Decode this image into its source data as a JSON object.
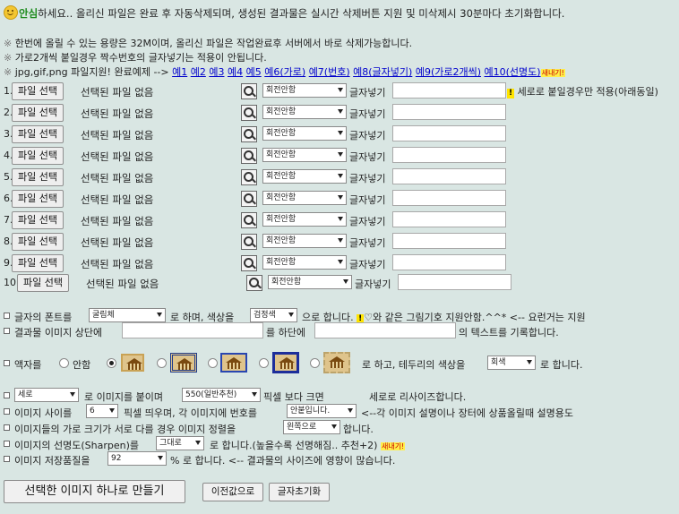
{
  "notice": {
    "safe": "안심",
    "text": "하세요.. 올리신 파일은 완료 후 자동삭제되며, 생성된 결과물은 실시간 삭제버튼 지원 및 미삭제시 30분마다 초기화합니다."
  },
  "info": {
    "mark": "※",
    "line1": "한번에 올릴 수 있는 용량은 32M이며, 올리신 파일은 작업완료후 서버에서 바로 삭제가능합니다.",
    "line2": "가로2개씩 붙일경우 짝수번호의 글자넣기는 적용이 안됩니다.",
    "line3_prefix": "jpg,gif,png 파일지원! 완료예제 -->",
    "examples": [
      "예1",
      "예2",
      "예3",
      "예4",
      "예5",
      "예6(가로)",
      "예7(번호)",
      "예8(글자넣기)",
      "예9(가로2개씩)",
      "예10(선명도)"
    ],
    "new_badge": "새내기!"
  },
  "file_rows": {
    "choose_label": "파일 선택",
    "no_file": "선택된 파일 없음",
    "rotate_value": "회전안함",
    "text_label": "글자넣기",
    "numbers": [
      "1.",
      "2.",
      "3.",
      "4.",
      "5.",
      "6.",
      "7.",
      "8.",
      "9.",
      "10."
    ],
    "row1_tip_mark": "!",
    "row1_tip": "세로로 붙일경우만 적용(아래동일)"
  },
  "font_row": {
    "p1": "글자의 폰트를",
    "font": "굴림체",
    "p2": "로 하며, 색상을",
    "color": "검정색",
    "p3": "으로 합니다.",
    "excl": "!",
    "p4": "♡와 같은 그림기호 지원안함.^^* <-- 요런거는 지원"
  },
  "record_row": {
    "p1": "결과물 이미지 상단에",
    "p2": "를 하단에",
    "p3": "의 텍스트를 기록합니다."
  },
  "frame_row": {
    "p1": "액자를",
    "none": "안함",
    "p2": "로 하고, 테두리의 색상을",
    "border_color": "회색",
    "p3": "로 합니다."
  },
  "options": {
    "direction": "세로",
    "o1a": "로 이미지를 붙이며",
    "size": "550(일반추천)",
    "o1b": "픽셀 보다 크면",
    "o1c": "세로로 리사이즈합니다.",
    "gap_label": "이미지 사이를",
    "gap": "6",
    "o2a": "픽셀 띄우며, 각 이미지에 번호를",
    "number_opt": "안붙입니다.",
    "o2b": "<--각 이미지 설명이나 장터에 상품올릴때 설명용도",
    "o3a": "이미지들의 가로 크기가 서로 다를 경우 이미지 정렬을",
    "align": "왼쪽으로",
    "o3b": "합니다.",
    "o4a": "이미지의 선명도(Sharpen)를",
    "sharpen": "그대로",
    "o4b": "로 합니다.(높을수록 선명해짐.. 추천+2)",
    "o4badge": "새내기!",
    "o5a": "이미지 저장품질을",
    "quality": "92",
    "o5b": "% 로 합니다. <-- 결과물의 사이즈에 영향이 많습니다."
  },
  "actions": {
    "make": "선택한 이미지 하나로 만들기",
    "prev": "이전값으로",
    "reset": "글자초기화"
  },
  "colors": {
    "background": "#d9e6e3",
    "link": "#0000cc",
    "safe_green": "#1b8a1b"
  }
}
